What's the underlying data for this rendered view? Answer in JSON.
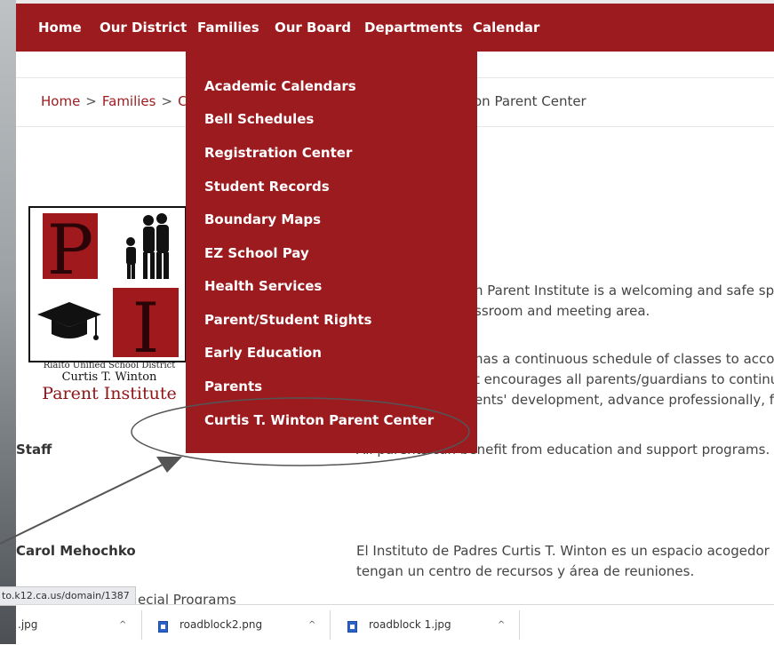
{
  "nav": {
    "items": [
      "Home",
      "Our District",
      "Families",
      "Our Board",
      "Departments",
      "Calendar"
    ]
  },
  "breadcrumb": {
    "home": "Home",
    "sep": ">",
    "families": "Families",
    "current_fragment": "C",
    "tail_visible": "on Parent Center"
  },
  "dropdown": {
    "items": [
      "Academic Calendars",
      "Bell Schedules",
      "Registration Center",
      "Student Records",
      "Boundary Maps",
      "EZ School Pay",
      "Health Services",
      "Parent/Student Rights",
      "Early Education",
      "Parents",
      "Curtis T. Winton Parent Center"
    ]
  },
  "logo": {
    "letters": [
      "P",
      "I"
    ],
    "caption_line1": "Rialto Unified School District",
    "caption_line2": "Curtis T. Winton",
    "caption_line3": "Parent Institute"
  },
  "content": {
    "en_line1": "n Parent Institute is a welcoming and safe space",
    "en_line2": "ssroom and meeting area.",
    "en_line3": "has a continuous schedule of classes to accomm",
    "en_line4": "t encourages all parents/guardians to continue",
    "en_line5": "ents' development, advance professionally, feel",
    "en_line6": "All parents can benefit from education and support programs.",
    "es_line1": "El Instituto de Padres Curtis T. Winton es un espacio acogedor y seg",
    "es_line2": "tengan un centro de recursos y área de reuniones."
  },
  "staff": {
    "label": "Staff",
    "name": "Carol Mehochko",
    "program": "ecial Programs"
  },
  "status_url": "to.k12.ca.us/domain/1387",
  "downloads": {
    "items": [
      ".jpg",
      "roadblock2.png",
      "roadblock 1.jpg"
    ],
    "chevron": "^"
  },
  "colors": {
    "brand": "#9b1b1f",
    "annotation": "#555555"
  }
}
